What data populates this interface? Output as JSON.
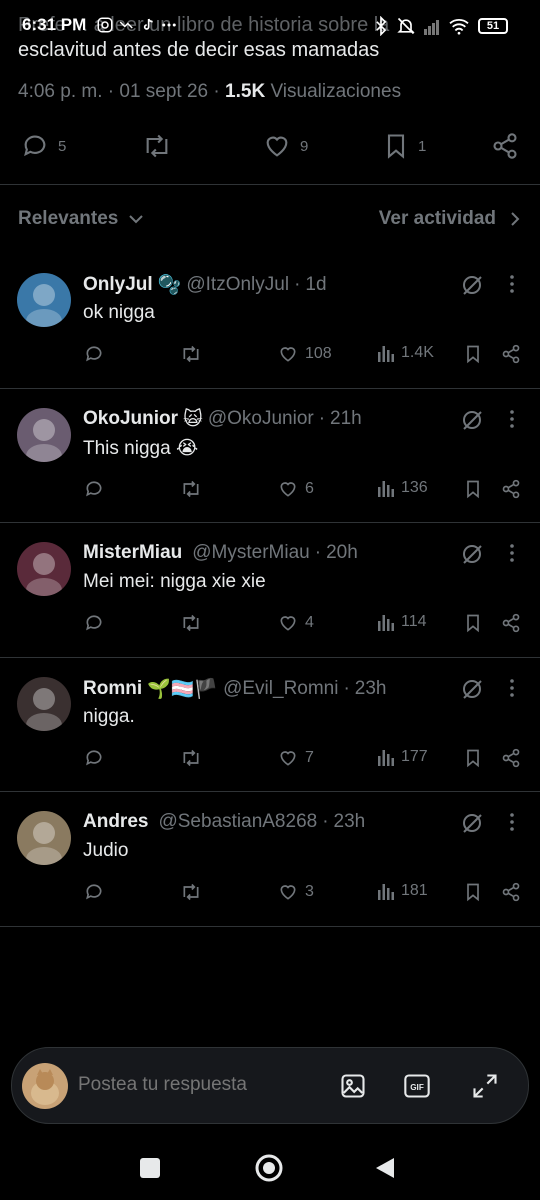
{
  "status_bar": {
    "time": "6:31 PM",
    "battery": "51"
  },
  "tweet": {
    "text_line1_faded": "Prefe ... a leer un libro de historia sobre la",
    "text_line2": "esclavitud antes de decir esas mamadas",
    "time": "4:06 p. m.",
    "date": "01 sept 26",
    "views_count": "1.5K",
    "views_label": "Visualizaciones",
    "replies": "5",
    "likes": "9",
    "bookmarks": "1"
  },
  "sort": {
    "left_label": "Relevantes",
    "right_label": "Ver actividad"
  },
  "replies": [
    {
      "name": "OnlyJul",
      "badge": "🫧",
      "handle": "@ItzOnlyJul",
      "time": "1d",
      "text": "ok nigga",
      "likes": "108",
      "views": "1.4K",
      "avatar_color": "#3a78a8"
    },
    {
      "name": "OkoJunior",
      "badge": "🙀",
      "handle": "@OkoJunior",
      "time": "21h",
      "text": "This nigga 😭",
      "likes": "6",
      "views": "136",
      "avatar_color": "#6a5c70"
    },
    {
      "name": "MisterMiau",
      "badge": "",
      "handle": "@MysterMiau",
      "time": "20h",
      "text": "Mei mei: nigga xie xie",
      "likes": "4",
      "views": "114",
      "avatar_color": "#5a2a3a"
    },
    {
      "name": "Romni",
      "badge": "🌱🏳️‍⚧️🏴",
      "handle": "@Evil_Romni",
      "time": "23h",
      "text": "nigga.",
      "likes": "7",
      "views": "177",
      "avatar_color": "#3a3030"
    },
    {
      "name": "Andres",
      "badge": "",
      "handle": "@SebastianA8268",
      "time": "23h",
      "text": "Judio",
      "likes": "3",
      "views": "181",
      "avatar_color": "#8a7a60"
    }
  ],
  "compose": {
    "placeholder": "Postea tu respuesta",
    "gif_label": "GIF"
  },
  "colors": {
    "background": "#000000",
    "text": "#e7e9ea",
    "muted": "#71767b",
    "divider": "#2f3336"
  }
}
